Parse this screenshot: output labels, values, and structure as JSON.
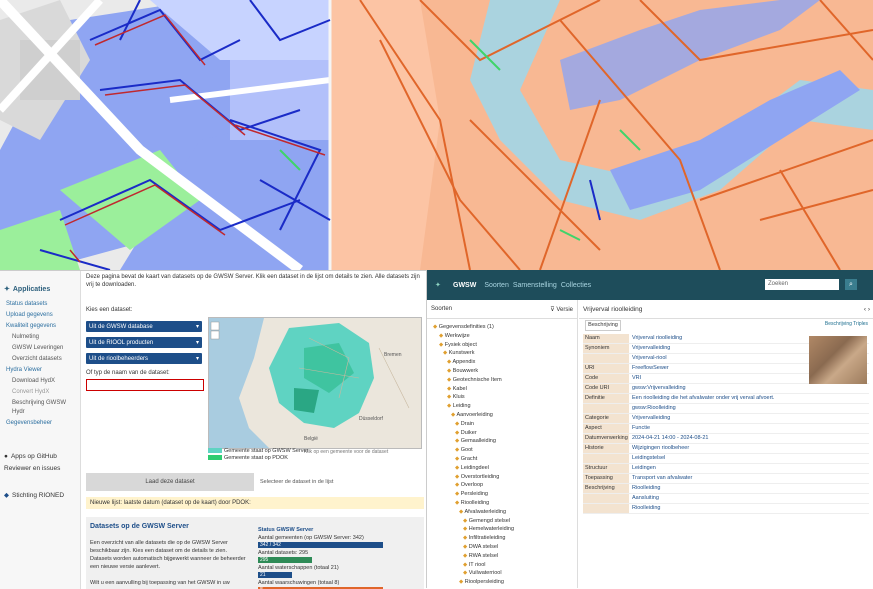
{
  "app1": {
    "intro": "Deze pagina bevat de kaart van datasets op de GWSW Server. Klik een dataset in de lijst om details te zien. Alle datasets zijn vrij te downloaden.",
    "sidebar": {
      "title": "Applicaties",
      "items": [
        "Status datasets",
        "Upload gegevens",
        "Kwaliteit gegevens",
        "Nulmeting",
        "GWSW Leveringen",
        "Overzicht datasets",
        "Hydra Viewer",
        "Download HydX",
        "Convert HydX",
        "Beschrijving GWSW Hydr",
        "Gegevensbeheer"
      ],
      "github": "Apps op GitHub",
      "issues": "Reviewer en issues",
      "org": "Stichting RIONED"
    },
    "select_label": "Kies een dataset:",
    "selects": [
      "Uit de GWSW database",
      "Uit de RIOOL producten",
      "Uit de rioolbeheerders"
    ],
    "text_label": "Of typ de naam van de dataset:",
    "legend": [
      "Gemeente staat op GWSW Server",
      "Gemeente staat op PDOK"
    ],
    "legend_note": "Klik op een gemeente voor de dataset",
    "load_button": "Laad deze dataset",
    "alt_note": "Selecteer de dataset in de lijst",
    "notice": "Nieuwe lijst: laatste datum (dataset op de kaart) door PDOK: ",
    "datasets_title": "Datasets op de GWSW Server",
    "datasets_text": "Een overzicht van alle datasets die op de GWSW Server beschikbaar zijn. Kies een dataset om de details te zien. Datasets worden automatisch bijgewerkt wanneer de beheerder een nieuwe versie aanlevert.",
    "datasets_text2": "Wilt u een aanvulling bij toepassing van het GWSW in uw",
    "stats_title": "Status GWSW Server",
    "stats": [
      {
        "label": "Aantal gemeenten (op GWSW Server: 342)",
        "pct": 0.76,
        "color": "#1d4e89",
        "text": "342 / 342"
      },
      {
        "label": "Aantal datasets: 295",
        "pct": 0.32,
        "color": "#2e8b57",
        "text": "295"
      },
      {
        "label": "Aantal waterschappen (totaal 21)",
        "pct": 0.2,
        "color": "#1d4e89",
        "text": "21"
      },
      {
        "label": "Aantal waarschuwingen (totaal 8)",
        "pct": 0.76,
        "color": "#e0662a",
        "text": "8"
      }
    ]
  },
  "app2": {
    "logo": "GWSW",
    "nav": [
      "Soorten",
      "Samenstelling",
      "Collecties"
    ],
    "search_placeholder": "Zoeken",
    "left_title": "Soorten",
    "left_version": "Versie",
    "tree": [
      "Gegevensdefinities (1)",
      "Werkwijze",
      "Fysiek object",
      "Kunstwerk",
      "Appendix",
      "Bouwwerk",
      "Geotechnische Item",
      "Kabel",
      "Kluis",
      "Leiding",
      "Aanvoerleiding",
      "Drain",
      "Duiker",
      "Gemaalleiding",
      "Goot",
      "Gracht",
      "Leidingdeel",
      "Overstortleiding",
      "Overloop",
      "Persleiding",
      "Rioolleiding",
      "Afvalwaterleiding",
      "Gemengd stelsel",
      "Hemelwaterleiding",
      "Infiltratieleiding",
      "DWA stelsel",
      "RWA stelsel",
      "IT riool",
      "Vuilwaterriool",
      "Rioolpersleiding"
    ],
    "right_title": "Vrijverval rioolleiding",
    "tab": "Beschrijving",
    "tablink": "Beschrijving  Triples",
    "rows": [
      [
        "Naam",
        "Vrijverval rioolleiding"
      ],
      [
        "Synoniem",
        "Vrijvervalleiding"
      ],
      [
        "",
        "Vrijverval-riool"
      ],
      [
        "URI",
        "FreeflowSewer"
      ],
      [
        "Code",
        "VRI"
      ],
      [
        "Code URI",
        "gwsw:Vrijvervalleiding"
      ],
      [
        "Definitie",
        "Een rioolleiding die het afvalwater onder vrij verval afvoert."
      ],
      [
        "",
        "gwsw:Rioolleiding"
      ],
      [
        "Categorie",
        "Vrijvervalleiding"
      ],
      [
        "Aspect",
        "Functie"
      ],
      [
        "Datumverwerking",
        "2024-04-21 14:00 - 2024-08-21"
      ],
      [
        "Historie",
        "Wijzigingen rioolbeheer"
      ],
      [
        "",
        "Leidingstelsel"
      ],
      [
        "Structuur",
        "Leidingen"
      ],
      [
        "Toepassing",
        "Transport van afvalwater"
      ],
      [
        "Beschrijving",
        "Rioolleiding"
      ],
      [
        "",
        "Aansluiting"
      ],
      [
        "",
        "Rioolleiding"
      ]
    ]
  }
}
